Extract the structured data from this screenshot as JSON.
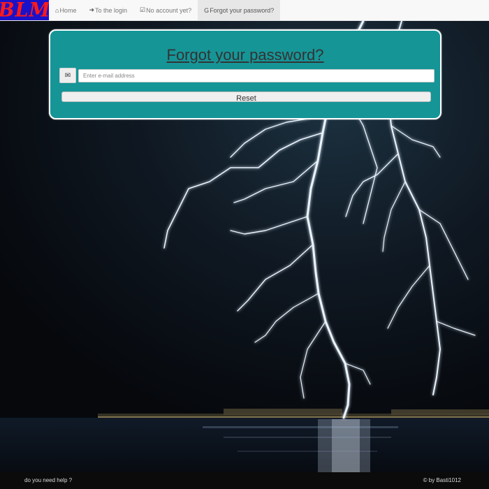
{
  "brand": {
    "logo_text": "BLM",
    "colors": {
      "background": "#1a12c9",
      "text": "#ff1a1a"
    }
  },
  "nav": {
    "items": [
      {
        "icon": "home-icon",
        "label": "Home"
      },
      {
        "icon": "login-icon",
        "label": "To the login"
      },
      {
        "icon": "check-icon",
        "label": "No account yet?"
      },
      {
        "icon": "google-icon",
        "label": "Forgot your password?",
        "active": true
      }
    ]
  },
  "form": {
    "title": "Forgot your password?",
    "email_icon": "envelope-icon",
    "email_placeholder": "Enter e-mail address",
    "email_value": "",
    "reset_label": "Reset"
  },
  "footer": {
    "help_text": "do you need help ?",
    "copyright": "© by Basti1012"
  },
  "colors": {
    "card": "#169597",
    "navbar": "#f8f8f8",
    "footer": "#0b0b0b"
  }
}
